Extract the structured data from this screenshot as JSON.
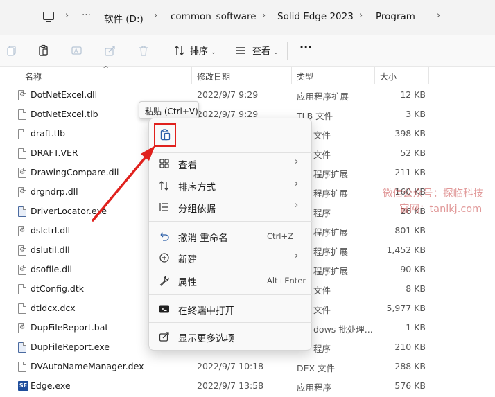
{
  "address": {
    "more_label": "···",
    "crumbs": [
      "软件 (D:)",
      "common_software",
      "Solid Edge 2023",
      "Program"
    ]
  },
  "toolbar": {
    "sort_label": "排序",
    "view_label": "查看",
    "more_label": "···"
  },
  "columns": {
    "name": "名称",
    "date": "修改日期",
    "type": "类型",
    "size": "大小"
  },
  "files": [
    {
      "name": "DotNetExcel.dll",
      "date": "2022/9/7 9:29",
      "type": "应用程序扩展",
      "size": "12 KB",
      "icon": "gear"
    },
    {
      "name": "DotNetExcel.tlb",
      "date": "2022/9/7 9:29",
      "type": "TLB 文件",
      "size": "3 KB",
      "icon": "file"
    },
    {
      "name": "draft.tlb",
      "date": "",
      "type": "文件",
      "size": "398 KB",
      "icon": "file"
    },
    {
      "name": "DRAFT.VER",
      "date": "",
      "type": "文件",
      "size": "52 KB",
      "icon": "file"
    },
    {
      "name": "DrawingCompare.dll",
      "date": "",
      "type": "程序扩展",
      "size": "211 KB",
      "icon": "gear"
    },
    {
      "name": "drgndrp.dll",
      "date": "",
      "type": "程序扩展",
      "size": "160 KB",
      "icon": "gear"
    },
    {
      "name": "DriverLocator.exe",
      "date": "",
      "type": "程序",
      "size": "26 KB",
      "icon": "app"
    },
    {
      "name": "dslctrl.dll",
      "date": "",
      "type": "程序扩展",
      "size": "801 KB",
      "icon": "gear"
    },
    {
      "name": "dslutil.dll",
      "date": "",
      "type": "程序扩展",
      "size": "1,452 KB",
      "icon": "gear"
    },
    {
      "name": "dsofile.dll",
      "date": "",
      "type": "程序扩展",
      "size": "90 KB",
      "icon": "gear"
    },
    {
      "name": "dtConfig.dtk",
      "date": "",
      "type": "文件",
      "size": "8 KB",
      "icon": "file"
    },
    {
      "name": "dtldcx.dcx",
      "date": "",
      "type": "文件",
      "size": "5,977 KB",
      "icon": "file"
    },
    {
      "name": "DupFileReport.bat",
      "date": "",
      "type": "dows 批处理...",
      "size": "1 KB",
      "icon": "gear"
    },
    {
      "name": "DupFileReport.exe",
      "date": "",
      "type": "程序",
      "size": "210 KB",
      "icon": "app"
    },
    {
      "name": "DVAutoNameManager.dex",
      "date": "2022/9/7 10:18",
      "type": "DEX 文件",
      "size": "288 KB",
      "icon": "file"
    },
    {
      "name": "Edge.exe",
      "date": "2022/9/7 13:58",
      "type": "应用程序",
      "size": "576 KB",
      "icon": "edge"
    }
  ],
  "edge_badge": "SE",
  "tooltip": "粘贴 (Ctrl+V)",
  "menu": {
    "items": [
      {
        "label": "查看",
        "shortcut": "",
        "submenu": true,
        "icon": "grid-icon"
      },
      {
        "label": "排序方式",
        "shortcut": "",
        "submenu": true,
        "icon": "sort-icon"
      },
      {
        "label": "分组依据",
        "shortcut": "",
        "submenu": true,
        "icon": "group-icon"
      },
      {
        "label": "撤消 重命名",
        "shortcut": "Ctrl+Z",
        "submenu": false,
        "icon": "undo-icon"
      },
      {
        "label": "新建",
        "shortcut": "",
        "submenu": true,
        "icon": "plus-circle-icon"
      },
      {
        "label": "属性",
        "shortcut": "Alt+Enter",
        "submenu": false,
        "icon": "wrench-icon"
      },
      {
        "label": "在终端中打开",
        "shortcut": "",
        "submenu": false,
        "icon": "terminal-icon"
      },
      {
        "label": "显示更多选项",
        "shortcut": "",
        "submenu": false,
        "icon": "share-icon"
      }
    ],
    "chevron": "›"
  },
  "watermark": {
    "line1": "微信公众号：探临科技",
    "line2": "官网：tanlkj.com"
  },
  "colors": {
    "highlight_red": "#e0211d",
    "accent_blue": "#005fb8"
  }
}
